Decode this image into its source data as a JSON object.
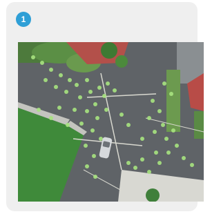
{
  "step": {
    "number": "1"
  },
  "colors": {
    "badge": "#2f9fd6",
    "card": "#efefef",
    "asphalt": "#5d6165",
    "grass": "#3f8a3a",
    "roof": "#b8504a",
    "dots": "#9ee07a"
  },
  "image": {
    "subject": "aerial-intersection-photo",
    "icon": "aerial-street-intersection-image"
  }
}
